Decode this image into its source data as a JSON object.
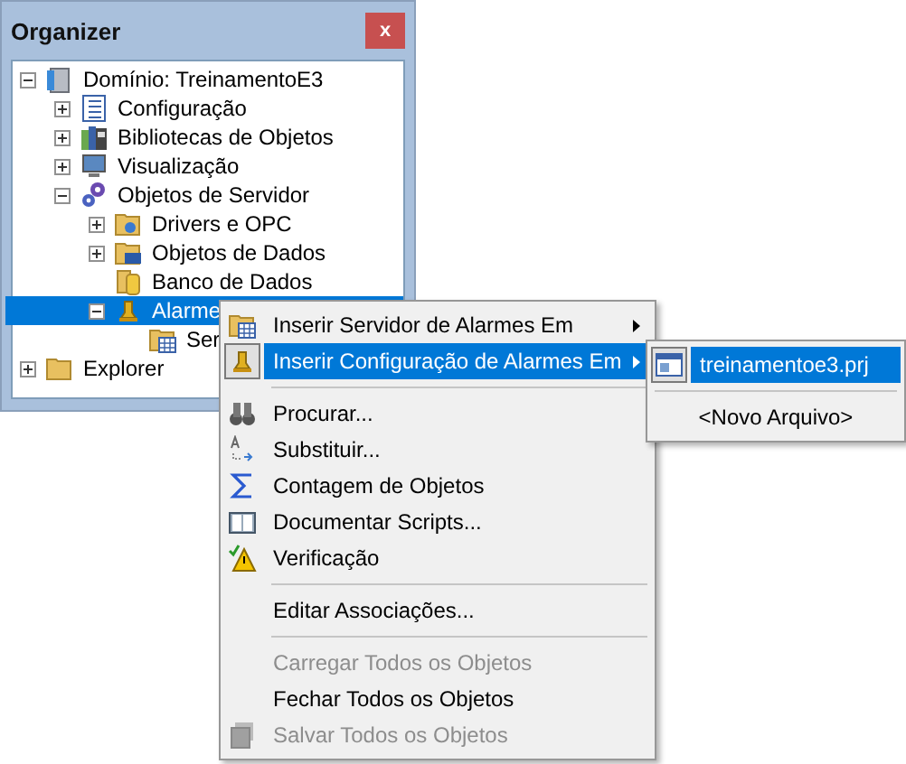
{
  "organizer": {
    "title": "Organizer",
    "close": "x",
    "tree": [
      {
        "label": "Domínio: TreinamentoE3",
        "expanded": true,
        "selected": false,
        "children": [
          {
            "label": "Configuração",
            "expanded": false,
            "selected": false
          },
          {
            "label": "Bibliotecas de Objetos",
            "expanded": false,
            "selected": false
          },
          {
            "label": "Visualização",
            "expanded": false,
            "selected": false
          },
          {
            "label": "Objetos de Servidor",
            "expanded": true,
            "selected": false,
            "children": [
              {
                "label": "Drivers e OPC",
                "expanded": false,
                "selected": false
              },
              {
                "label": "Objetos de Dados",
                "expanded": false,
                "selected": false
              },
              {
                "label": "Banco de Dados",
                "selected": false
              },
              {
                "label": "Alarme",
                "expanded": true,
                "selected": true,
                "children": [
                  {
                    "label": "Ser",
                    "selected": false
                  }
                ]
              }
            ]
          }
        ]
      },
      {
        "label": "Explorer",
        "expanded": false,
        "selected": false
      }
    ]
  },
  "context_menu": {
    "items": [
      {
        "kind": "item",
        "label": "Inserir Servidor de Alarmes Em",
        "submenu": true,
        "selected": false,
        "disabled": false
      },
      {
        "kind": "item",
        "label": "Inserir Configuração de Alarmes Em",
        "submenu": true,
        "selected": true,
        "disabled": false
      },
      {
        "kind": "separator"
      },
      {
        "kind": "item",
        "label": "Procurar...",
        "submenu": false,
        "selected": false,
        "disabled": false
      },
      {
        "kind": "item",
        "label": "Substituir...",
        "submenu": false,
        "selected": false,
        "disabled": false
      },
      {
        "kind": "item",
        "label": "Contagem de Objetos",
        "submenu": false,
        "selected": false,
        "disabled": false
      },
      {
        "kind": "item",
        "label": "Documentar Scripts...",
        "submenu": false,
        "selected": false,
        "disabled": false
      },
      {
        "kind": "item",
        "label": "Verificação",
        "submenu": false,
        "selected": false,
        "disabled": false
      },
      {
        "kind": "separator"
      },
      {
        "kind": "item",
        "label": "Editar Associações...",
        "submenu": false,
        "selected": false,
        "disabled": false
      },
      {
        "kind": "separator"
      },
      {
        "kind": "item",
        "label": "Carregar Todos os Objetos",
        "submenu": false,
        "selected": false,
        "disabled": true
      },
      {
        "kind": "item",
        "label": "Fechar Todos os Objetos",
        "submenu": false,
        "selected": false,
        "disabled": false
      },
      {
        "kind": "item",
        "label": "Salvar Todos os Objetos",
        "submenu": false,
        "selected": false,
        "disabled": true
      }
    ]
  },
  "submenu": {
    "items": [
      {
        "kind": "item",
        "label": "treinamentoe3.prj",
        "selected": true
      },
      {
        "kind": "separator"
      },
      {
        "kind": "item",
        "label": "<Novo Arquivo>",
        "selected": false
      }
    ]
  }
}
